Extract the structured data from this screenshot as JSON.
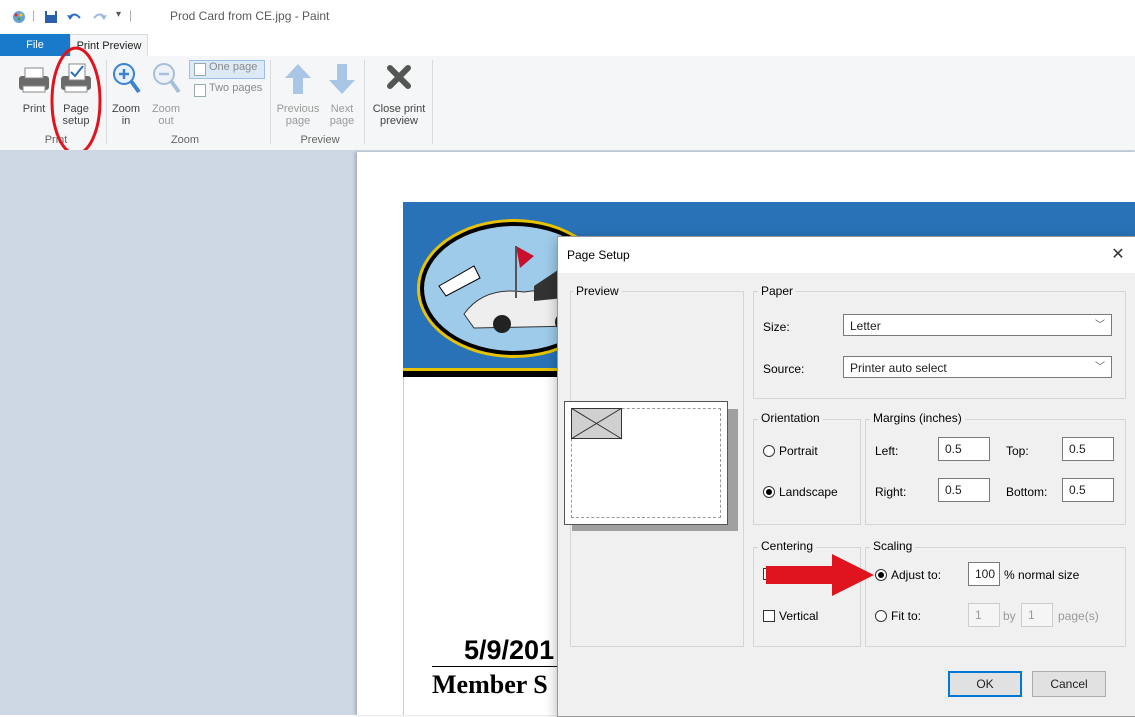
{
  "window": {
    "title": "Prod Card from CE.jpg - Paint"
  },
  "tabs": {
    "file": "File",
    "print_preview": "Print Preview"
  },
  "ribbon": {
    "print": "Print",
    "page_setup_1": "Page",
    "page_setup_2": "setup",
    "zoom_in_1": "Zoom",
    "zoom_in_2": "in",
    "zoom_out_1": "Zoom",
    "zoom_out_2": "out",
    "one_page": "One page",
    "two_pages": "Two pages",
    "prev_1": "Previous",
    "prev_2": "page",
    "next_1": "Next",
    "next_2": "page",
    "close_1": "Close print",
    "close_2": "preview",
    "group_print": "Print",
    "group_zoom": "Zoom",
    "group_preview": "Preview"
  },
  "document": {
    "date": "5/9/201",
    "member": "Member S"
  },
  "dialog": {
    "title": "Page Setup",
    "preview_label": "Preview",
    "paper_label": "Paper",
    "size_label": "Size:",
    "size_value": "Letter",
    "source_label": "Source:",
    "source_value": "Printer auto select",
    "orientation_label": "Orientation",
    "portrait": "Portrait",
    "landscape": "Landscape",
    "margins_label": "Margins (inches)",
    "left_label": "Left:",
    "left_value": "0.5",
    "top_label": "Top:",
    "top_value": "0.5",
    "right_label": "Right:",
    "right_value": "0.5",
    "bottom_label": "Bottom:",
    "bottom_value": "0.5",
    "centering_label": "Centering",
    "vertical": "Vertical",
    "scaling_label": "Scaling",
    "adjust_to": "Adjust to:",
    "adjust_value": "100",
    "normal_size": "% normal size",
    "fit_to": "Fit to:",
    "fit_w": "1",
    "by": "by",
    "fit_h": "1",
    "pages": "page(s)",
    "ok": "OK",
    "cancel": "Cancel"
  },
  "annotations": {
    "circle_color": "#e0141e",
    "arrow_color": "#e0141e"
  }
}
